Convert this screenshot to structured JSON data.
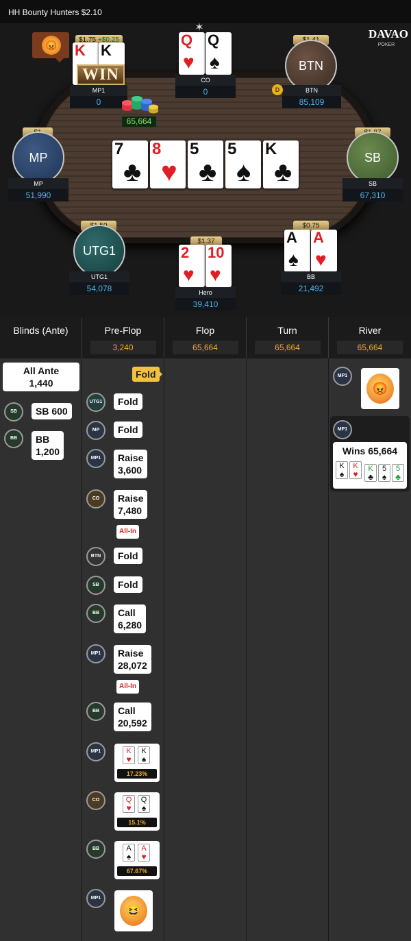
{
  "title": "HH  Bounty Hunters $2.10",
  "logo": {
    "main": "DAVAO",
    "sub": "POKER"
  },
  "table": {
    "pot": "65,664",
    "win_badge": "WIN",
    "players": {
      "mp1": {
        "name": "MP1",
        "stack": "0",
        "stake": "$1.75",
        "stake_change": "+$0.25",
        "cards": [
          {
            "rank": "K",
            "suit": "♥",
            "color": "red"
          },
          {
            "rank": "K",
            "suit": "♠",
            "color": "blk"
          }
        ]
      },
      "co": {
        "name": "CO",
        "stack": "0",
        "cards": [
          {
            "rank": "Q",
            "suit": "♥",
            "color": "red"
          },
          {
            "rank": "Q",
            "suit": "♠",
            "color": "blk"
          }
        ]
      },
      "btn": {
        "name": "BTN",
        "stack": "85,109",
        "stake": "$1.41",
        "avatar": "BTN",
        "dealer": "D"
      },
      "mp": {
        "name": "MP",
        "stack": "51,990",
        "stake": "$1",
        "avatar": "MP"
      },
      "sb": {
        "name": "SB",
        "stack": "67,310",
        "stake": "$1.87",
        "avatar": "SB"
      },
      "utg1": {
        "name": "UTG1",
        "stack": "54,078",
        "stake": "$1.50",
        "avatar": "UTG1"
      },
      "hero": {
        "name": "Hero",
        "stack": "39,410",
        "stake": "$1.37",
        "cards": [
          {
            "rank": "2",
            "suit": "♥",
            "color": "red"
          },
          {
            "rank": "10",
            "suit": "♥",
            "color": "red"
          }
        ]
      },
      "bb": {
        "name": "BB",
        "stack": "21,492",
        "stake": "$0.75",
        "cards": [
          {
            "rank": "A",
            "suit": "♠",
            "color": "blk"
          },
          {
            "rank": "A",
            "suit": "♥",
            "color": "red"
          }
        ]
      }
    },
    "board": [
      {
        "rank": "7",
        "suit": "♣",
        "color": "blk"
      },
      {
        "rank": "8",
        "suit": "♥",
        "color": "red"
      },
      {
        "rank": "5",
        "suit": "♣",
        "color": "blk"
      },
      {
        "rank": "5",
        "suit": "♠",
        "color": "blk"
      },
      {
        "rank": "K",
        "suit": "♣",
        "color": "blk"
      }
    ]
  },
  "streets": {
    "headers": [
      {
        "title": "Blinds (Ante)",
        "pot": ""
      },
      {
        "title": "Pre-Flop",
        "pot": "3,240"
      },
      {
        "title": "Flop",
        "pot": "65,664"
      },
      {
        "title": "Turn",
        "pot": "65,664"
      },
      {
        "title": "River",
        "pot": "65,664"
      }
    ],
    "blinds": {
      "ante_label": "All Ante",
      "ante_value": "1,440",
      "sb_chip": "SB",
      "sb_text": "SB  600",
      "bb_chip": "BB",
      "bb_label": "BB",
      "bb_value": "1,200"
    },
    "preflop": {
      "fold_tag": "Fold",
      "actions": [
        {
          "chip": "UTG1",
          "line1": "Fold",
          "line2": ""
        },
        {
          "chip": "MP",
          "line1": "Fold",
          "line2": ""
        },
        {
          "chip": "MP1",
          "line1": "Raise",
          "line2": "3,600"
        },
        {
          "chip": "CO",
          "line1": "Raise",
          "line2": "7,480",
          "allin": "All-In"
        },
        {
          "chip": "BTN",
          "line1": "Fold",
          "line2": ""
        },
        {
          "chip": "SB",
          "line1": "Fold",
          "line2": ""
        },
        {
          "chip": "BB",
          "line1": "Call",
          "line2": "6,280"
        },
        {
          "chip": "MP1",
          "line1": "Raise",
          "line2": "28,072",
          "allin": "All-In"
        },
        {
          "chip": "BB",
          "line1": "Call",
          "line2": "20,592"
        }
      ],
      "showdowns": [
        {
          "chip": "MP1",
          "cards": [
            {
              "rank": "K",
              "suit": "♥",
              "color": "red"
            },
            {
              "rank": "K",
              "suit": "♠",
              "color": "blk"
            }
          ],
          "equity": "17.23%"
        },
        {
          "chip": "CO",
          "cards": [
            {
              "rank": "Q",
              "suit": "♥",
              "color": "red"
            },
            {
              "rank": "Q",
              "suit": "♠",
              "color": "blk"
            }
          ],
          "equity": "15.1%"
        },
        {
          "chip": "BB",
          "cards": [
            {
              "rank": "A",
              "suit": "♠",
              "color": "blk"
            },
            {
              "rank": "A",
              "suit": "♥",
              "color": "red"
            }
          ],
          "equity": "67.67%"
        }
      ],
      "emote_chip": "MP1"
    },
    "river": {
      "emote_chip": "MP1",
      "winner_chip": "MP1",
      "wins_text": "Wins 65,664",
      "cards": [
        {
          "rank": "K",
          "suit": "♠",
          "color": "blk"
        },
        {
          "rank": "K",
          "suit": "♥",
          "color": "red"
        },
        {
          "rank": "K",
          "suit": "♣",
          "color": "grn"
        },
        {
          "rank": "5",
          "suit": "♠",
          "color": "blk"
        },
        {
          "rank": "5",
          "suit": "♣",
          "color": "grn"
        }
      ]
    }
  }
}
